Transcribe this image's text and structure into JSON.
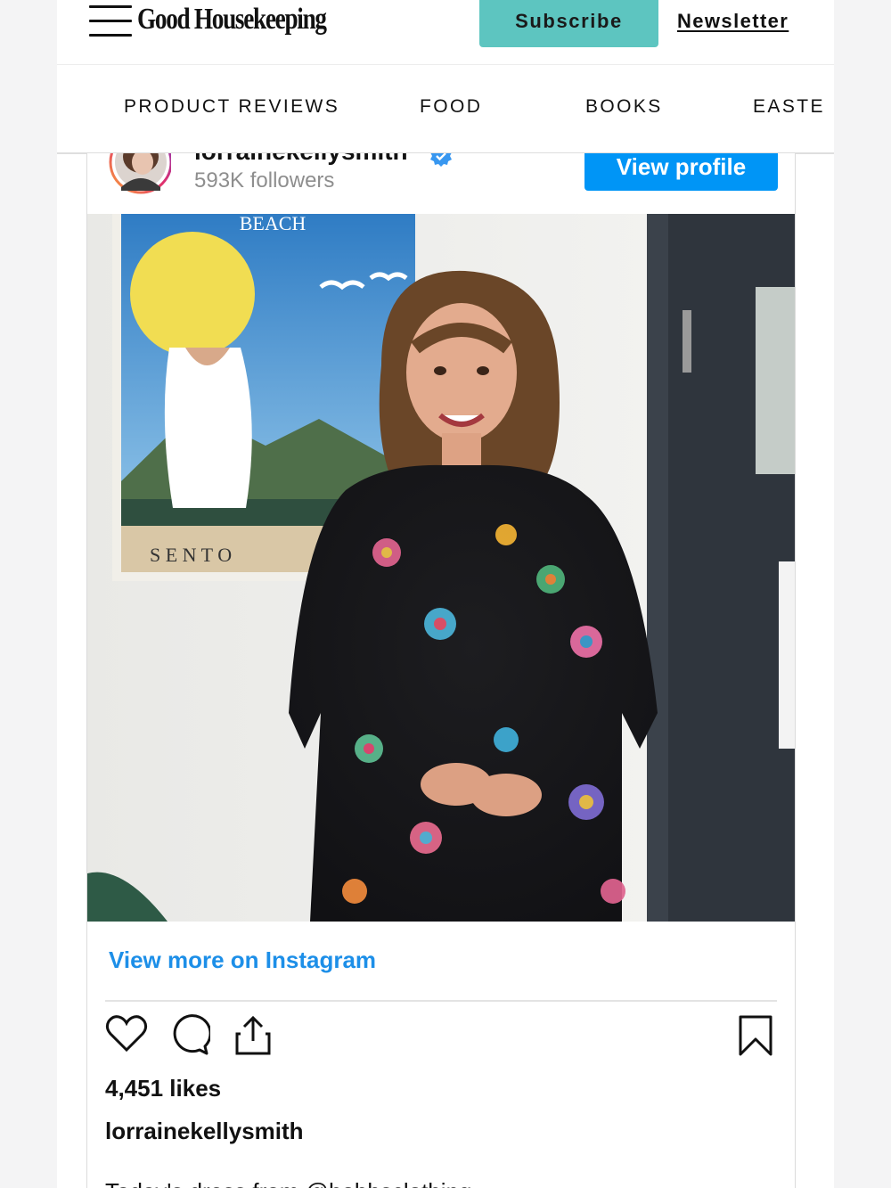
{
  "header": {
    "brand": "Good Housekeeping",
    "subscribe_label": "Subscribe",
    "newsletter_label": "Newsletter",
    "accent_color": "#5dc5c0"
  },
  "nav": {
    "items": [
      "PRODUCT REVIEWS",
      "FOOD",
      "BOOKS",
      "EASTE"
    ]
  },
  "instagram": {
    "username": "lorrainekellysmith",
    "verified_icon": "verified-badge-icon",
    "followers": "593K followers",
    "view_profile_label": "View profile",
    "photo": {
      "poster_top_text": "BEACH",
      "poster_bottom_text": "S E N T O"
    },
    "view_more_label": "View more on Instagram",
    "actions": [
      "heart-icon",
      "comment-icon",
      "share-icon",
      "bookmark-icon"
    ],
    "likes": "4,451 likes",
    "caption_username": "lorrainekellysmith",
    "caption_preview": "Today's dress from @hobbsclothing",
    "link_color": "#0095f6"
  }
}
